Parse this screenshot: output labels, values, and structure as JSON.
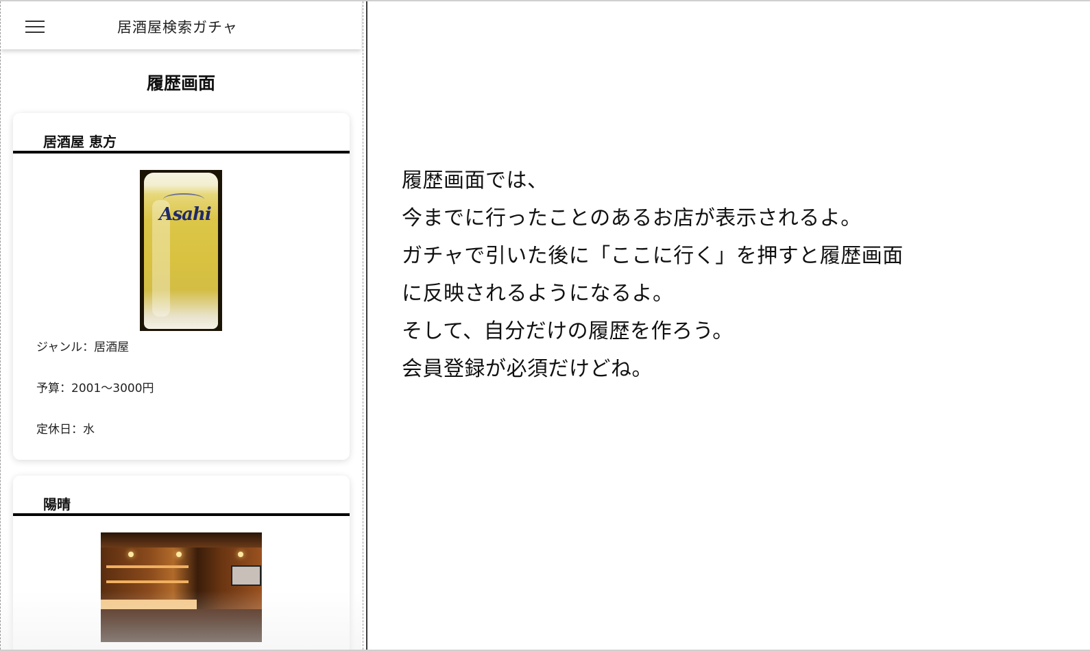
{
  "app": {
    "title": "居酒屋検索ガチャ",
    "menu_icon": "hamburger-menu-icon"
  },
  "page": {
    "heading": "履歴画面"
  },
  "history": [
    {
      "name": "居酒屋 恵方",
      "photo": "beer-mug-photo",
      "photo_text": "Asahi",
      "genre": "ジャンル：居酒屋",
      "budget": "予算：2001〜3000円",
      "holiday": "定休日：水"
    },
    {
      "name": "陽晴",
      "photo": "bar-interior-photo"
    }
  ],
  "explanation": {
    "lines": [
      "履歴画面では、",
      "今までに行ったことのあるお店が表示されるよ。",
      "ガチャで引いた後に「ここに行く」を押すと履歴画面",
      "に反映されるようになるよ。",
      "そして、自分だけの履歴を作ろう。",
      "会員登録が必須だけどね。"
    ]
  },
  "colors": {
    "card_rule": "#000000",
    "text": "#111111",
    "background": "#ffffff"
  }
}
